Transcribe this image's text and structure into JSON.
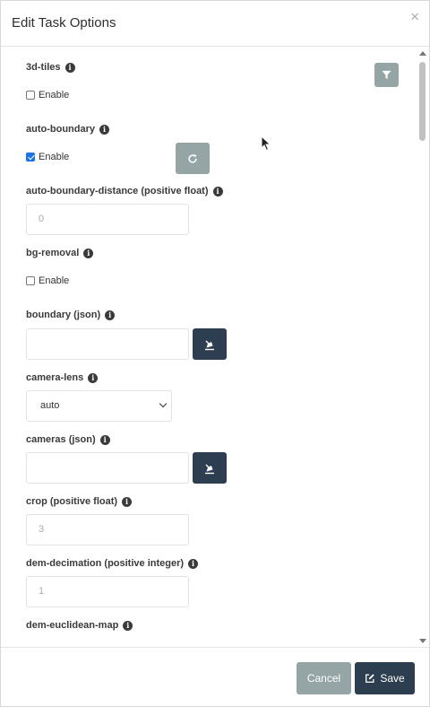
{
  "dialog": {
    "title": "Edit Task Options",
    "close_symbol": "×"
  },
  "options": {
    "tiles_3d": {
      "label": "3d-tiles",
      "checkbox_label": "Enable",
      "checked": false
    },
    "auto_boundary": {
      "label": "auto-boundary",
      "checkbox_label": "Enable",
      "checked": true
    },
    "auto_boundary_distance": {
      "label": "auto-boundary-distance (positive float)",
      "placeholder": "0"
    },
    "bg_removal": {
      "label": "bg-removal",
      "checkbox_label": "Enable",
      "checked": false
    },
    "boundary": {
      "label": "boundary (json)",
      "value": ""
    },
    "camera_lens": {
      "label": "camera-lens",
      "selected": "auto"
    },
    "cameras": {
      "label": "cameras (json)",
      "value": ""
    },
    "crop": {
      "label": "crop (positive float)",
      "placeholder": "3"
    },
    "dem_decimation": {
      "label": "dem-decimation (positive integer)",
      "placeholder": "1"
    },
    "dem_euclidean_map": {
      "label": "dem-euclidean-map"
    }
  },
  "icons": {
    "info": "info-icon",
    "filter": "filter-icon",
    "refresh": "refresh-icon",
    "draw": "draw-icon",
    "save": "edit-icon"
  },
  "footer": {
    "cancel_label": "Cancel",
    "save_label": "Save"
  },
  "colors": {
    "primary": "#2c3e50",
    "secondary": "#95a5a6",
    "checkbox": "#1a73e8"
  }
}
